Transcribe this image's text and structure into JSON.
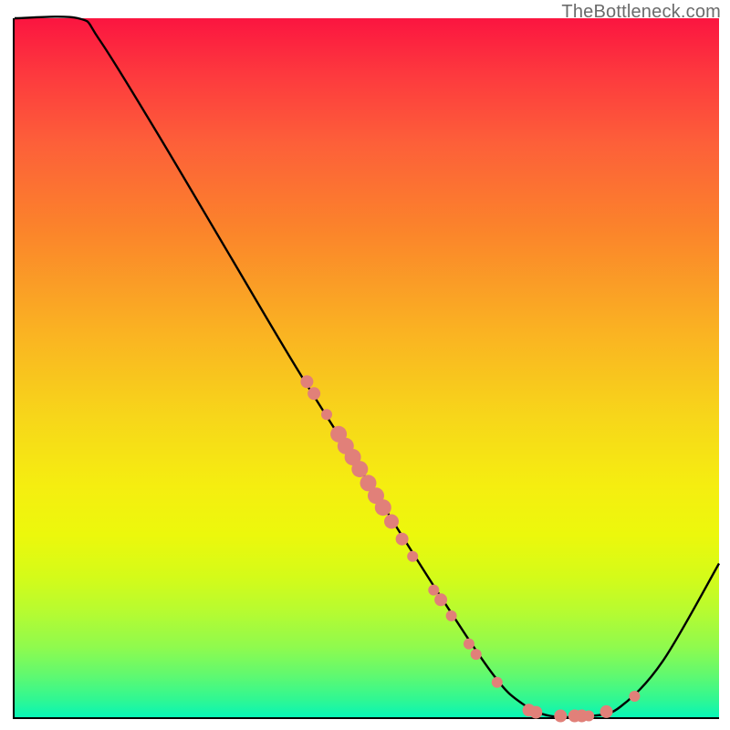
{
  "watermark": "TheBottleneck.com",
  "chart_data": {
    "type": "line",
    "title": "",
    "xlabel": "",
    "ylabel": "",
    "xlim": [
      0,
      100
    ],
    "ylim": [
      0,
      100
    ],
    "grid": false,
    "legend": false,
    "curve": [
      {
        "x": 0,
        "y": 100
      },
      {
        "x": 9,
        "y": 100
      },
      {
        "x": 12,
        "y": 97
      },
      {
        "x": 20,
        "y": 84
      },
      {
        "x": 30,
        "y": 67
      },
      {
        "x": 40,
        "y": 50
      },
      {
        "x": 50,
        "y": 34
      },
      {
        "x": 60,
        "y": 18
      },
      {
        "x": 68,
        "y": 6
      },
      {
        "x": 72,
        "y": 2
      },
      {
        "x": 76,
        "y": 0.2
      },
      {
        "x": 82,
        "y": 0.2
      },
      {
        "x": 86,
        "y": 1.5
      },
      {
        "x": 92,
        "y": 8
      },
      {
        "x": 100,
        "y": 22
      }
    ],
    "markers": [
      {
        "x": 41.5,
        "y": 48.0,
        "size": 7
      },
      {
        "x": 42.5,
        "y": 46.3,
        "size": 7
      },
      {
        "x": 44.3,
        "y": 43.3,
        "size": 6
      },
      {
        "x": 46.0,
        "y": 40.5,
        "size": 9
      },
      {
        "x": 47.0,
        "y": 38.8,
        "size": 9
      },
      {
        "x": 48.0,
        "y": 37.2,
        "size": 9
      },
      {
        "x": 49.0,
        "y": 35.5,
        "size": 9
      },
      {
        "x": 50.2,
        "y": 33.5,
        "size": 9
      },
      {
        "x": 51.3,
        "y": 31.7,
        "size": 9
      },
      {
        "x": 52.3,
        "y": 30.0,
        "size": 9
      },
      {
        "x": 53.5,
        "y": 28.0,
        "size": 8
      },
      {
        "x": 55.0,
        "y": 25.5,
        "size": 7
      },
      {
        "x": 56.5,
        "y": 23.0,
        "size": 6
      },
      {
        "x": 59.5,
        "y": 18.2,
        "size": 6
      },
      {
        "x": 60.5,
        "y": 16.8,
        "size": 7
      },
      {
        "x": 62.0,
        "y": 14.5,
        "size": 6
      },
      {
        "x": 64.5,
        "y": 10.5,
        "size": 6
      },
      {
        "x": 65.5,
        "y": 9.0,
        "size": 6
      },
      {
        "x": 68.5,
        "y": 5.0,
        "size": 6
      },
      {
        "x": 73.0,
        "y": 1.0,
        "size": 7
      },
      {
        "x": 74.0,
        "y": 0.7,
        "size": 7
      },
      {
        "x": 77.5,
        "y": 0.2,
        "size": 7
      },
      {
        "x": 79.5,
        "y": 0.2,
        "size": 7
      },
      {
        "x": 80.5,
        "y": 0.2,
        "size": 7
      },
      {
        "x": 81.5,
        "y": 0.2,
        "size": 6
      },
      {
        "x": 84.0,
        "y": 0.8,
        "size": 7
      },
      {
        "x": 88.0,
        "y": 3.0,
        "size": 6
      }
    ],
    "marker_color": "#e18079",
    "curve_color": "#000000",
    "gradient_colors": [
      "#fb1540",
      "#fd393e",
      "#fd6039",
      "#fb832b",
      "#fab322",
      "#f7d61a",
      "#f5ee10",
      "#ecf80c",
      "#d4fb19",
      "#b6fb31",
      "#8ffa4e",
      "#60f970",
      "#2ff793",
      "#08f6b6"
    ]
  }
}
